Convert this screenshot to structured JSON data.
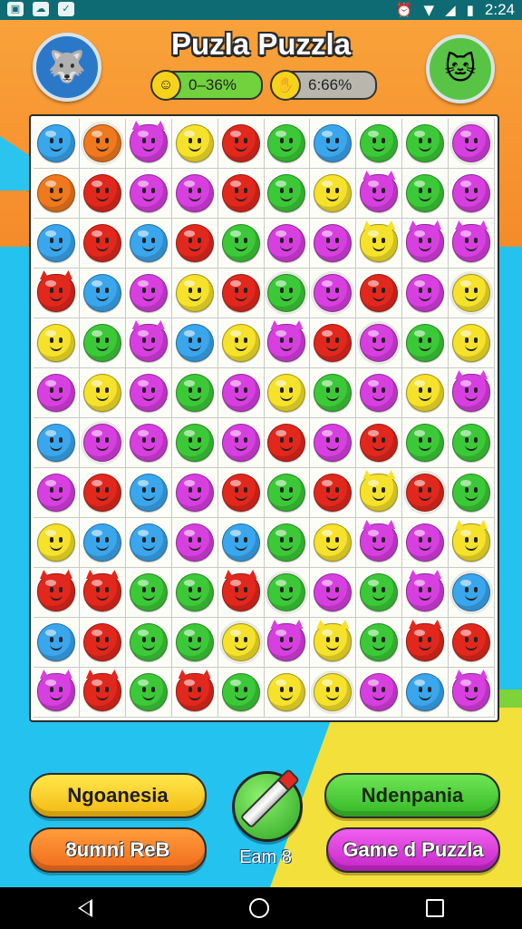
{
  "status_bar": {
    "time": "2:24",
    "left_icons": [
      "photo-icon",
      "cloud-icon",
      "download-icon"
    ],
    "right_icons": [
      "alarm-icon",
      "wifi-icon",
      "signal-icon",
      "battery-icon"
    ]
  },
  "header": {
    "title": "Puzla Puzzla",
    "stat_left": {
      "value": "0–36%",
      "icon": "face-icon"
    },
    "stat_right": {
      "value": "6:66%",
      "icon": "hand-icon"
    },
    "avatar_left": "wolf-avatar",
    "avatar_right": "cat-avatar"
  },
  "board": {
    "rows": [
      [
        "blue",
        "orange-fluffy",
        "magenta-cat",
        "yellow",
        "red",
        "green",
        "blue",
        "green",
        "green",
        "magenta-fluffy"
      ],
      [
        "orange",
        "red",
        "magenta",
        "magenta",
        "red",
        "green",
        "yellow",
        "magenta-cat",
        "green",
        "magenta"
      ],
      [
        "blue",
        "red",
        "blue",
        "red",
        "green",
        "magenta",
        "magenta",
        "yellow-cat",
        "magenta-cat",
        "magenta-cat"
      ],
      [
        "red-cat",
        "blue",
        "magenta",
        "yellow",
        "red",
        "green-fluffy",
        "magenta-fluffy",
        "red",
        "magenta",
        "yellow-fluffy"
      ],
      [
        "yellow",
        "green",
        "magenta-cat",
        "blue",
        "yellow",
        "magenta-cat",
        "red",
        "magenta-fluffy",
        "green",
        "yellow"
      ],
      [
        "magenta",
        "yellow",
        "magenta",
        "green",
        "magenta",
        "yellow",
        "green",
        "magenta",
        "yellow",
        "magenta-cat"
      ],
      [
        "blue",
        "magenta-fluffy",
        "magenta",
        "green",
        "magenta",
        "red",
        "magenta",
        "red",
        "green",
        "green"
      ],
      [
        "magenta",
        "red",
        "blue",
        "magenta",
        "red",
        "green",
        "red",
        "yellow-cat",
        "red-fluffy",
        "green"
      ],
      [
        "yellow",
        "blue",
        "blue",
        "magenta",
        "blue",
        "green",
        "yellow",
        "magenta-cat",
        "magenta",
        "yellow-cat"
      ],
      [
        "red-cat",
        "red-cat",
        "green",
        "green",
        "red-cat",
        "green-fluffy",
        "magenta",
        "green",
        "magenta-cat",
        "blue-fluffy"
      ],
      [
        "blue",
        "red",
        "green",
        "green",
        "yellow-fluffy",
        "magenta-cat",
        "yellow-cat",
        "green",
        "red-cat",
        "red"
      ],
      [
        "magenta-cat",
        "red-cat",
        "green",
        "red-cat",
        "green",
        "yellow",
        "yellow-fluffy",
        "magenta",
        "blue",
        "magenta-cat"
      ]
    ]
  },
  "buttons": {
    "top_left": "Ngoanesia",
    "bottom_left": "8umni ReB",
    "top_right": "Ndenpania",
    "bottom_right": "Game d Puzzla",
    "center_label": "Eam 8"
  },
  "colors": {
    "blue": "#3aa6ee",
    "red": "#e2271d",
    "magenta": "#d83fe0",
    "yellow": "#f6e22a",
    "green": "#3cc938",
    "orange": "#f0781d"
  }
}
